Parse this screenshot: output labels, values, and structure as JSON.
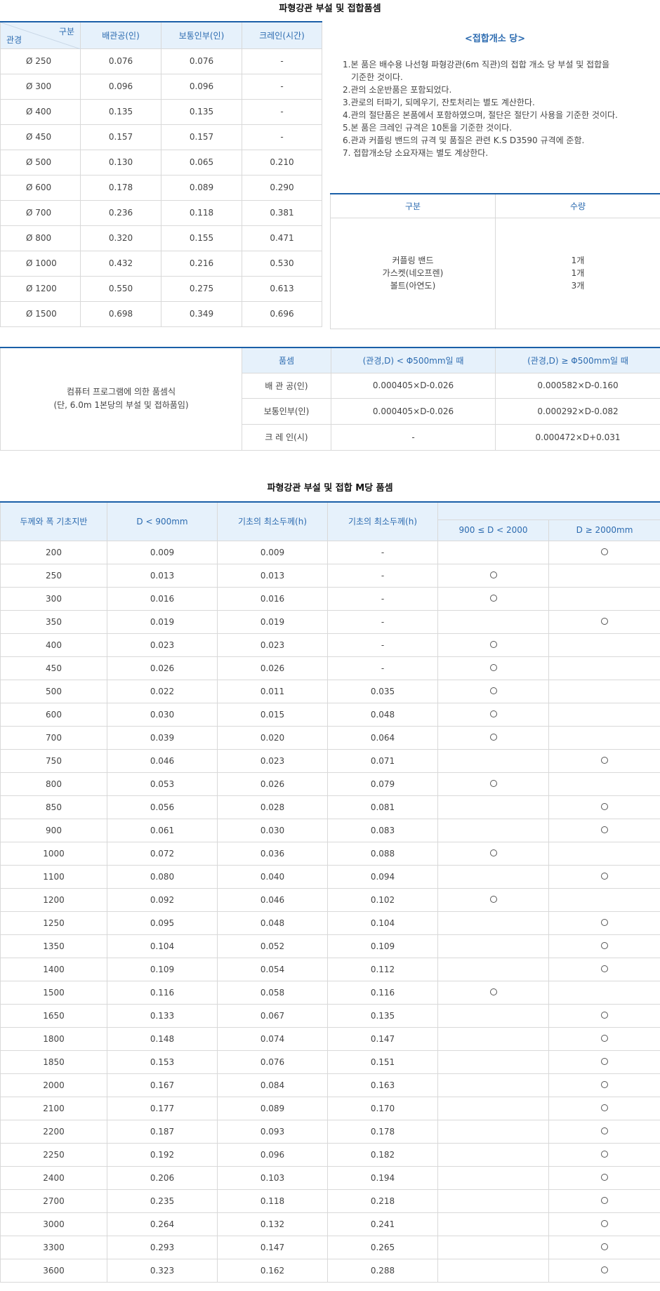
{
  "title1": "파형강관 부설 및 접합품셈",
  "spec_table": {
    "corner_top": "구분",
    "corner_bottom": "관경",
    "headers": [
      "배관공(인)",
      "보통인부(인)",
      "크레인(시간)"
    ],
    "rows": [
      {
        "d": "Ø  250",
        "a": "0.076",
        "b": "0.076",
        "c": "-"
      },
      {
        "d": "Ø  300",
        "a": "0.096",
        "b": "0.096",
        "c": "-"
      },
      {
        "d": "Ø  400",
        "a": "0.135",
        "b": "0.135",
        "c": "-"
      },
      {
        "d": "Ø  450",
        "a": "0.157",
        "b": "0.157",
        "c": "-"
      },
      {
        "d": "Ø  500",
        "a": "0.130",
        "b": "0.065",
        "c": "0.210"
      },
      {
        "d": "Ø  600",
        "a": "0.178",
        "b": "0.089",
        "c": "0.290"
      },
      {
        "d": "Ø  700",
        "a": "0.236",
        "b": "0.118",
        "c": "0.381"
      },
      {
        "d": "Ø  800",
        "a": "0.320",
        "b": "0.155",
        "c": "0.471"
      },
      {
        "d": "Ø  1000",
        "a": "0.432",
        "b": "0.216",
        "c": "0.530"
      },
      {
        "d": "Ø  1200",
        "a": "0.550",
        "b": "0.275",
        "c": "0.613"
      },
      {
        "d": "Ø  1500",
        "a": "0.698",
        "b": "0.349",
        "c": "0.696"
      }
    ]
  },
  "notes": {
    "title": "<접합개소 당>",
    "items": [
      [
        "1.본 품은 배수용 나선형 파형강관(6m 직관)의 접합 개소 당 부설 및 접합을",
        "기준한 것이다."
      ],
      [
        "2.관의 소운반품은 포함되었다."
      ],
      [
        "3.관로의 터파기, 되메우기, 잔토처리는 별도 계산한다."
      ],
      [
        "4.관의 절단품은 본품에서 포함하였으며, 절단은 절단기 사용을 기준한 것이다."
      ],
      [
        "5.본 품은 크레인 규격은 10톤을 기준한 것이다."
      ],
      [
        "6.관과 커플링 밴드의 규격 및 품질은 관련 K.S D3590 규격에 준함."
      ],
      [
        "7. 접합개소당 소요자재는 별도 계상한다."
      ]
    ]
  },
  "material_table": {
    "headers": [
      "구분",
      "수량"
    ],
    "items": [
      "커플링 밴드",
      "가스켓(네오프렌)",
      "볼트(아연도)"
    ],
    "qty": [
      "1개",
      "1개",
      "3개"
    ]
  },
  "formula_table": {
    "left_line1": "컴퓨터 프로그램에 의한 품셈식",
    "left_line2": "(단, 6.0m 1본당의 부설 및 접하품임)",
    "headers": [
      "품셈",
      "(관경,D) < Φ500mm일 때",
      "(관경,D) ≥ Φ500mm일 때"
    ],
    "rows": [
      {
        "name": "배 관 공(인)",
        "lt": "0.000405×D-0.026",
        "ge": "0.000582×D-0.160"
      },
      {
        "name": "보통인부(인)",
        "lt": "0.000405×D-0.026",
        "ge": "0.000292×D-0.082"
      },
      {
        "name": "크 레 인(시)",
        "lt": "-",
        "ge": "0.000472×D+0.031"
      }
    ]
  },
  "title2": "파형강관 부설 및 접합 M당 품셈",
  "m_table": {
    "headers": [
      "두께와 폭 기초지반",
      "D < 900mm",
      "기초의 최소두께(h)",
      "기초의 최소두께(h)",
      "",
      "900 ≤ D < 2000",
      "D ≥ 2000mm"
    ],
    "rows": [
      [
        "200",
        "0.009",
        "0.009",
        "-",
        false,
        true
      ],
      [
        "250",
        "0.013",
        "0.013",
        "-",
        true,
        false
      ],
      [
        "300",
        "0.016",
        "0.016",
        "-",
        true,
        false
      ],
      [
        "350",
        "0.019",
        "0.019",
        "-",
        false,
        true
      ],
      [
        "400",
        "0.023",
        "0.023",
        "-",
        true,
        false
      ],
      [
        "450",
        "0.026",
        "0.026",
        "-",
        true,
        false
      ],
      [
        "500",
        "0.022",
        "0.011",
        "0.035",
        true,
        false
      ],
      [
        "600",
        "0.030",
        "0.015",
        "0.048",
        true,
        false
      ],
      [
        "700",
        "0.039",
        "0.020",
        "0.064",
        true,
        false
      ],
      [
        "750",
        "0.046",
        "0.023",
        "0.071",
        false,
        true
      ],
      [
        "800",
        "0.053",
        "0.026",
        "0.079",
        true,
        false
      ],
      [
        "850",
        "0.056",
        "0.028",
        "0.081",
        false,
        true
      ],
      [
        "900",
        "0.061",
        "0.030",
        "0.083",
        false,
        true
      ],
      [
        "1000",
        "0.072",
        "0.036",
        "0.088",
        true,
        false
      ],
      [
        "1100",
        "0.080",
        "0.040",
        "0.094",
        false,
        true
      ],
      [
        "1200",
        "0.092",
        "0.046",
        "0.102",
        true,
        false
      ],
      [
        "1250",
        "0.095",
        "0.048",
        "0.104",
        false,
        true
      ],
      [
        "1350",
        "0.104",
        "0.052",
        "0.109",
        false,
        true
      ],
      [
        "1400",
        "0.109",
        "0.054",
        "0.112",
        false,
        true
      ],
      [
        "1500",
        "0.116",
        "0.058",
        "0.116",
        true,
        false
      ],
      [
        "1650",
        "0.133",
        "0.067",
        "0.135",
        false,
        true
      ],
      [
        "1800",
        "0.148",
        "0.074",
        "0.147",
        false,
        true
      ],
      [
        "1850",
        "0.153",
        "0.076",
        "0.151",
        false,
        true
      ],
      [
        "2000",
        "0.167",
        "0.084",
        "0.163",
        false,
        true
      ],
      [
        "2100",
        "0.177",
        "0.089",
        "0.170",
        false,
        true
      ],
      [
        "2200",
        "0.187",
        "0.093",
        "0.178",
        false,
        true
      ],
      [
        "2250",
        "0.192",
        "0.096",
        "0.182",
        false,
        true
      ],
      [
        "2400",
        "0.206",
        "0.103",
        "0.194",
        false,
        true
      ],
      [
        "2700",
        "0.235",
        "0.118",
        "0.218",
        false,
        true
      ],
      [
        "3000",
        "0.264",
        "0.132",
        "0.241",
        false,
        true
      ],
      [
        "3300",
        "0.293",
        "0.147",
        "0.265",
        false,
        true
      ],
      [
        "3600",
        "0.323",
        "0.162",
        "0.288",
        false,
        true
      ]
    ]
  }
}
